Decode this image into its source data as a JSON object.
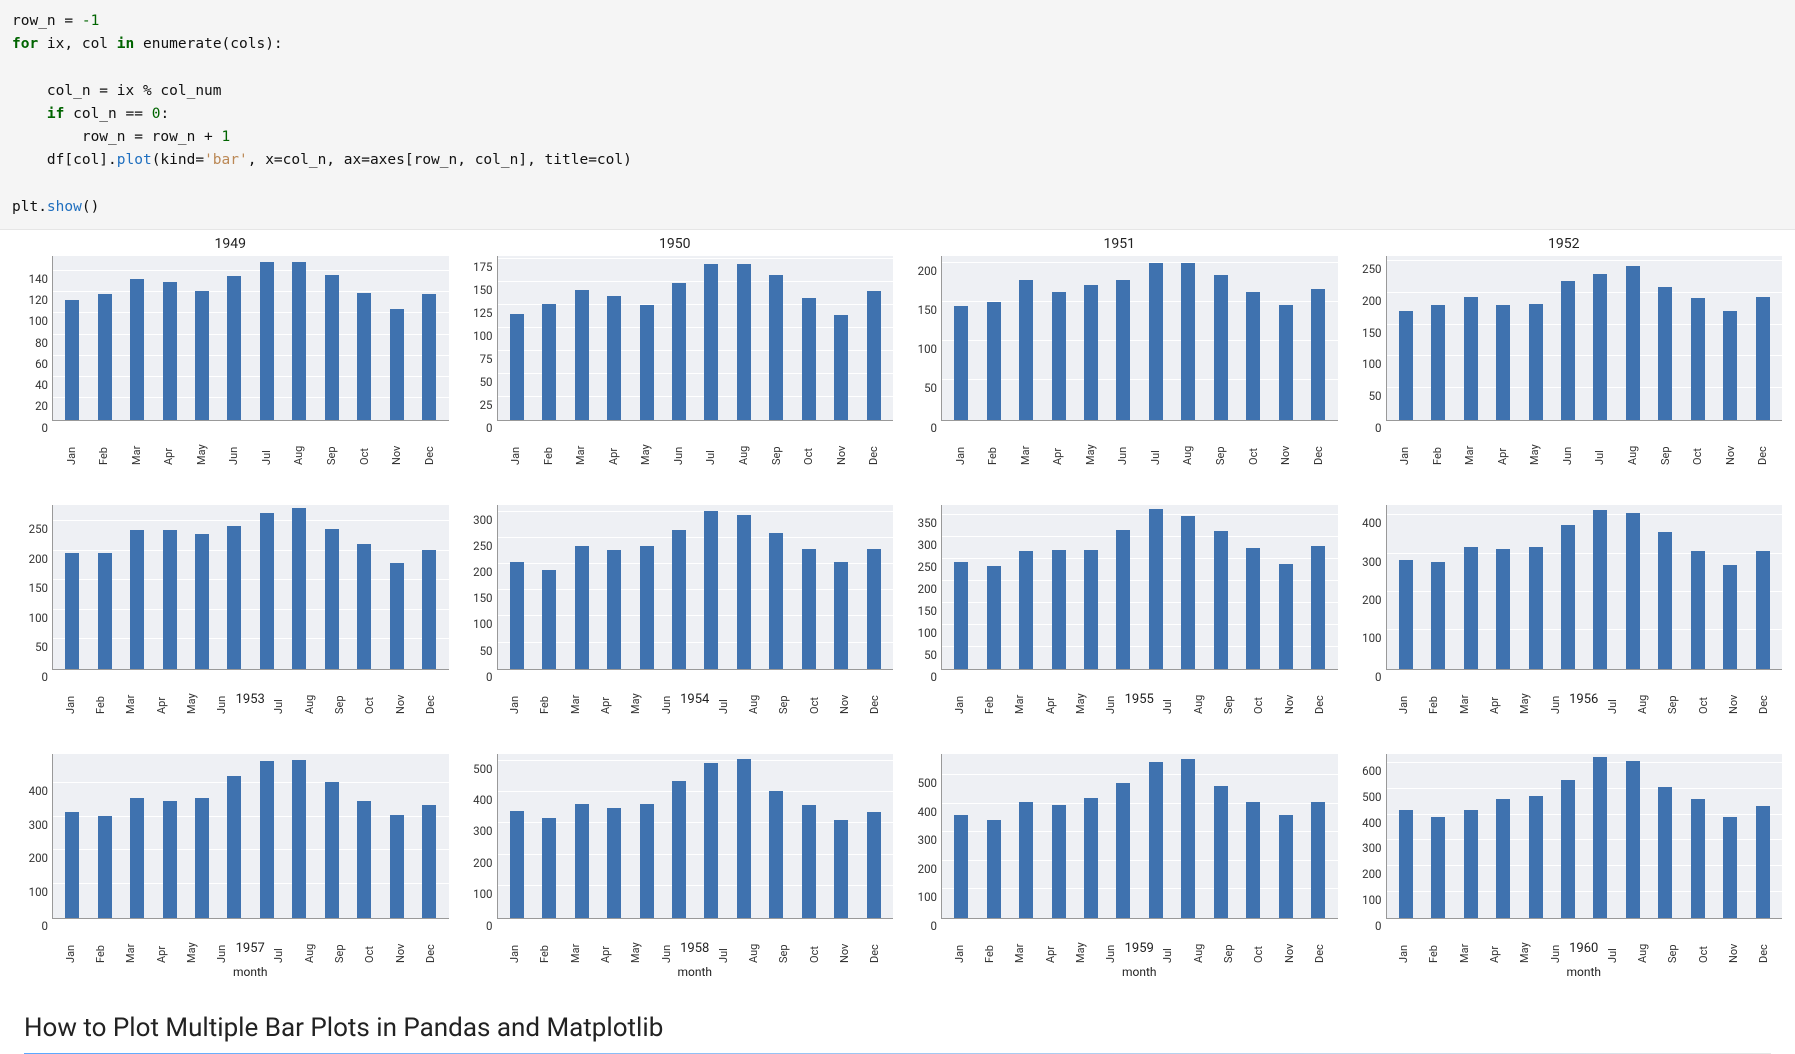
{
  "code": {
    "lines": [
      {
        "pre": "",
        "tokens": [
          {
            "t": "row_n",
            "c": ""
          },
          {
            "t": " = ",
            "c": ""
          },
          {
            "t": "-1",
            "c": "num"
          }
        ]
      },
      {
        "pre": "",
        "tokens": [
          {
            "t": "for",
            "c": "kw"
          },
          {
            "t": " ix, col ",
            "c": ""
          },
          {
            "t": "in",
            "c": "kw"
          },
          {
            "t": " enumerate(cols):",
            "c": ""
          }
        ]
      },
      {
        "pre": "",
        "tokens": [
          {
            "t": "",
            "c": ""
          }
        ]
      },
      {
        "pre": "    ",
        "tokens": [
          {
            "t": "col_n = ix % col_num",
            "c": ""
          }
        ]
      },
      {
        "pre": "    ",
        "tokens": [
          {
            "t": "if",
            "c": "kw"
          },
          {
            "t": " col_n == ",
            "c": ""
          },
          {
            "t": "0",
            "c": "num"
          },
          {
            "t": ":",
            "c": ""
          }
        ]
      },
      {
        "pre": "        ",
        "tokens": [
          {
            "t": "row_n = row_n + ",
            "c": ""
          },
          {
            "t": "1",
            "c": "num"
          }
        ]
      },
      {
        "pre": "    ",
        "tokens": [
          {
            "t": "df[col].",
            "c": ""
          },
          {
            "t": "plot",
            "c": "fn"
          },
          {
            "t": "(kind=",
            "c": ""
          },
          {
            "t": "'bar'",
            "c": "str"
          },
          {
            "t": ", x=col_n, ax=axes[row_n, col_n], title=col)",
            "c": ""
          }
        ]
      },
      {
        "pre": "",
        "tokens": [
          {
            "t": "",
            "c": ""
          }
        ]
      },
      {
        "pre": "",
        "tokens": [
          {
            "t": "plt.",
            "c": ""
          },
          {
            "t": "show",
            "c": "fn"
          },
          {
            "t": "()",
            "c": ""
          }
        ]
      }
    ]
  },
  "months": [
    "Jan",
    "Feb",
    "Mar",
    "Apr",
    "May",
    "Jun",
    "Jul",
    "Aug",
    "Sep",
    "Oct",
    "Nov",
    "Dec"
  ],
  "xlabel": "month",
  "heading": "How to Plot Multiple Bar Plots in Pandas and Matplotlib",
  "chart_data": [
    {
      "title": "1949",
      "type": "bar",
      "categories": [
        "Jan",
        "Feb",
        "Mar",
        "Apr",
        "May",
        "Jun",
        "Jul",
        "Aug",
        "Sep",
        "Oct",
        "Nov",
        "Dec"
      ],
      "values": [
        112,
        118,
        132,
        129,
        121,
        135,
        148,
        148,
        136,
        119,
        104,
        118
      ],
      "yticks": [
        0,
        20,
        40,
        60,
        80,
        100,
        120,
        140
      ],
      "ymax": 155,
      "xlabel": "",
      "show_title": true
    },
    {
      "title": "1950",
      "type": "bar",
      "categories": [
        "Jan",
        "Feb",
        "Mar",
        "Apr",
        "May",
        "Jun",
        "Jul",
        "Aug",
        "Sep",
        "Oct",
        "Nov",
        "Dec"
      ],
      "values": [
        115,
        126,
        141,
        135,
        125,
        149,
        170,
        170,
        158,
        133,
        114,
        140
      ],
      "yticks": [
        0,
        25,
        50,
        75,
        100,
        125,
        150,
        175
      ],
      "ymax": 180,
      "xlabel": "",
      "show_title": true
    },
    {
      "title": "1951",
      "type": "bar",
      "categories": [
        "Jan",
        "Feb",
        "Mar",
        "Apr",
        "May",
        "Jun",
        "Jul",
        "Aug",
        "Sep",
        "Oct",
        "Nov",
        "Dec"
      ],
      "values": [
        145,
        150,
        178,
        163,
        172,
        178,
        199,
        199,
        184,
        162,
        146,
        166
      ],
      "yticks": [
        0,
        50,
        100,
        150,
        200
      ],
      "ymax": 210,
      "xlabel": "",
      "show_title": true
    },
    {
      "title": "1952",
      "type": "bar",
      "categories": [
        "Jan",
        "Feb",
        "Mar",
        "Apr",
        "May",
        "Jun",
        "Jul",
        "Aug",
        "Sep",
        "Oct",
        "Nov",
        "Dec"
      ],
      "values": [
        171,
        180,
        193,
        181,
        183,
        218,
        230,
        242,
        209,
        191,
        172,
        194
      ],
      "yticks": [
        0,
        50,
        100,
        150,
        200,
        250
      ],
      "ymax": 260,
      "xlabel": "",
      "show_title": true
    },
    {
      "title": "1953",
      "type": "bar",
      "categories": [
        "Jan",
        "Feb",
        "Mar",
        "Apr",
        "May",
        "Jun",
        "Jul",
        "Aug",
        "Sep",
        "Oct",
        "Nov",
        "Dec"
      ],
      "values": [
        196,
        196,
        236,
        235,
        229,
        243,
        264,
        272,
        237,
        211,
        180,
        201
      ],
      "yticks": [
        0,
        50,
        100,
        150,
        200,
        250
      ],
      "ymax": 280,
      "xlabel": "",
      "show_title": false
    },
    {
      "title": "1954",
      "type": "bar",
      "categories": [
        "Jan",
        "Feb",
        "Mar",
        "Apr",
        "May",
        "Jun",
        "Jul",
        "Aug",
        "Sep",
        "Oct",
        "Nov",
        "Dec"
      ],
      "values": [
        204,
        188,
        235,
        227,
        234,
        264,
        302,
        293,
        259,
        229,
        203,
        229
      ],
      "yticks": [
        0,
        50,
        100,
        150,
        200,
        250,
        300
      ],
      "ymax": 315,
      "xlabel": "",
      "show_title": false
    },
    {
      "title": "1955",
      "type": "bar",
      "categories": [
        "Jan",
        "Feb",
        "Mar",
        "Apr",
        "May",
        "Jun",
        "Jul",
        "Aug",
        "Sep",
        "Oct",
        "Nov",
        "Dec"
      ],
      "values": [
        242,
        233,
        267,
        269,
        270,
        315,
        364,
        347,
        312,
        274,
        237,
        278
      ],
      "yticks": [
        0,
        50,
        100,
        150,
        200,
        250,
        300,
        350
      ],
      "ymax": 375,
      "xlabel": "",
      "show_title": false
    },
    {
      "title": "1956",
      "type": "bar",
      "categories": [
        "Jan",
        "Feb",
        "Mar",
        "Apr",
        "May",
        "Jun",
        "Jul",
        "Aug",
        "Sep",
        "Oct",
        "Nov",
        "Dec"
      ],
      "values": [
        284,
        277,
        317,
        313,
        318,
        374,
        413,
        405,
        355,
        306,
        271,
        306
      ],
      "yticks": [
        0,
        100,
        200,
        300,
        400
      ],
      "ymax": 430,
      "xlabel": "",
      "show_title": false
    },
    {
      "title": "1957",
      "type": "bar",
      "categories": [
        "Jan",
        "Feb",
        "Mar",
        "Apr",
        "May",
        "Jun",
        "Jul",
        "Aug",
        "Sep",
        "Oct",
        "Nov",
        "Dec"
      ],
      "values": [
        315,
        301,
        356,
        348,
        355,
        422,
        465,
        467,
        404,
        347,
        305,
        336
      ],
      "yticks": [
        0,
        100,
        200,
        300,
        400
      ],
      "ymax": 490,
      "xlabel": "month",
      "show_title": false
    },
    {
      "title": "1958",
      "type": "bar",
      "categories": [
        "Jan",
        "Feb",
        "Mar",
        "Apr",
        "May",
        "Jun",
        "Jul",
        "Aug",
        "Sep",
        "Oct",
        "Nov",
        "Dec"
      ],
      "values": [
        340,
        318,
        362,
        348,
        363,
        435,
        491,
        505,
        404,
        359,
        310,
        337
      ],
      "yticks": [
        0,
        100,
        200,
        300,
        400,
        500
      ],
      "ymax": 525,
      "xlabel": "month",
      "show_title": false
    },
    {
      "title": "1959",
      "type": "bar",
      "categories": [
        "Jan",
        "Feb",
        "Mar",
        "Apr",
        "May",
        "Jun",
        "Jul",
        "Aug",
        "Sep",
        "Oct",
        "Nov",
        "Dec"
      ],
      "values": [
        360,
        342,
        406,
        396,
        420,
        472,
        548,
        559,
        463,
        407,
        362,
        405
      ],
      "yticks": [
        0,
        100,
        200,
        300,
        400,
        500
      ],
      "ymax": 580,
      "xlabel": "month",
      "show_title": false
    },
    {
      "title": "1960",
      "type": "bar",
      "categories": [
        "Jan",
        "Feb",
        "Mar",
        "Apr",
        "May",
        "Jun",
        "Jul",
        "Aug",
        "Sep",
        "Oct",
        "Nov",
        "Dec"
      ],
      "values": [
        417,
        391,
        419,
        461,
        472,
        535,
        622,
        606,
        508,
        461,
        390,
        432
      ],
      "yticks": [
        0,
        100,
        200,
        300,
        400,
        500,
        600
      ],
      "ymax": 640,
      "xlabel": "month",
      "show_title": false
    }
  ]
}
